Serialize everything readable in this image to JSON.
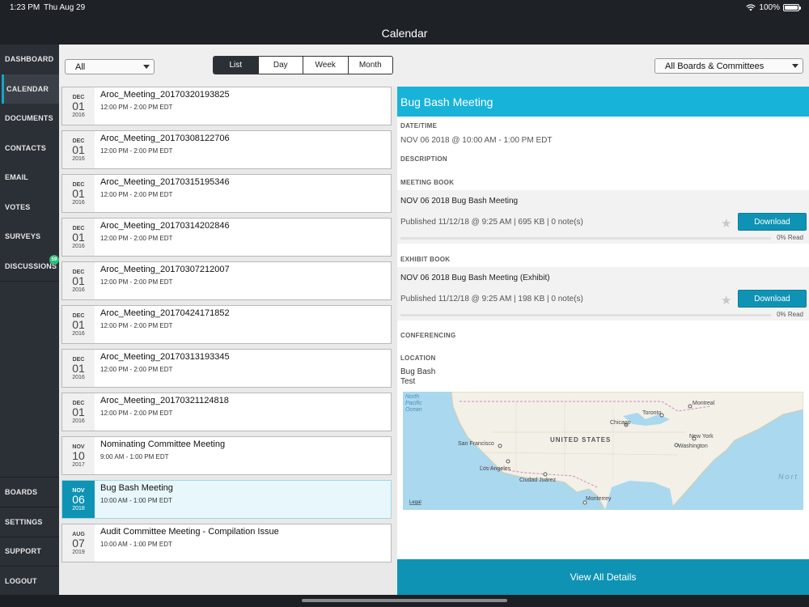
{
  "status_bar": {
    "time": "1:23 PM",
    "date": "Thu Aug 29",
    "battery": "100%",
    "battery_level": 1.0
  },
  "app_title": "Calendar",
  "sidebar": {
    "top_items": [
      {
        "label": "DASHBOARD"
      },
      {
        "label": "CALENDAR",
        "active": true
      },
      {
        "label": "DOCUMENTS"
      },
      {
        "label": "CONTACTS"
      },
      {
        "label": "EMAIL"
      },
      {
        "label": "VOTES"
      },
      {
        "label": "SURVEYS"
      },
      {
        "label": "DISCUSSIONS",
        "badge": "59"
      }
    ],
    "bottom_items": [
      {
        "label": "BOARDS"
      },
      {
        "label": "SETTINGS"
      },
      {
        "label": "SUPPORT"
      },
      {
        "label": "LOGOUT"
      }
    ]
  },
  "filters": {
    "type_select": "All",
    "view_tabs": [
      "List",
      "Day",
      "Week",
      "Month"
    ],
    "active_view": "List",
    "board_select": "All Boards & Committees"
  },
  "events": [
    {
      "mon": "DEC",
      "day": "01",
      "year": "2016",
      "title": "Aroc_Meeting_20170320193825",
      "time": "12:00 PM - 2:00 PM EDT"
    },
    {
      "mon": "DEC",
      "day": "01",
      "year": "2016",
      "title": "Aroc_Meeting_20170308122706",
      "time": "12:00 PM - 2:00 PM EDT"
    },
    {
      "mon": "DEC",
      "day": "01",
      "year": "2016",
      "title": "Aroc_Meeting_20170315195346",
      "time": "12:00 PM - 2:00 PM EDT"
    },
    {
      "mon": "DEC",
      "day": "01",
      "year": "2016",
      "title": "Aroc_Meeting_20170314202846",
      "time": "12:00 PM - 2:00 PM EDT"
    },
    {
      "mon": "DEC",
      "day": "01",
      "year": "2016",
      "title": "Aroc_Meeting_20170307212007",
      "time": "12:00 PM - 2:00 PM EDT"
    },
    {
      "mon": "DEC",
      "day": "01",
      "year": "2016",
      "title": "Aroc_Meeting_20170424171852",
      "time": "12:00 PM - 2:00 PM EDT"
    },
    {
      "mon": "DEC",
      "day": "01",
      "year": "2016",
      "title": "Aroc_Meeting_20170313193345",
      "time": "12:00 PM - 2:00 PM EDT"
    },
    {
      "mon": "DEC",
      "day": "01",
      "year": "2016",
      "title": "Aroc_Meeting_20170321124818",
      "time": "12:00 PM - 2:00 PM EDT"
    },
    {
      "mon": "NOV",
      "day": "10",
      "year": "2017",
      "title": "Nominating Committee Meeting",
      "time": "9:00 AM - 1:00 PM EDT"
    },
    {
      "mon": "NOV",
      "day": "06",
      "year": "2018",
      "title": "Bug Bash Meeting",
      "time": "10:00 AM - 1:00 PM EDT",
      "selected": true
    },
    {
      "mon": "AUG",
      "day": "07",
      "year": "2019",
      "title": "Audit Committee Meeting - Compilation Issue",
      "time": "10:00 AM - 1:00 PM EDT"
    }
  ],
  "detail": {
    "title": "Bug Bash Meeting",
    "datetime_label": "DATE/TIME",
    "datetime_value": "NOV 06 2018 @ 10:00 AM - 1:00 PM EDT",
    "description_label": "DESCRIPTION",
    "meeting_book_label": "MEETING BOOK",
    "meeting_book": {
      "title": "NOV 06 2018 Bug Bash Meeting",
      "meta": "Published 11/12/18 @ 9:25 AM | 695 KB | 0 note(s)",
      "button": "Download",
      "read": "0% Read",
      "read_fraction": 0.0
    },
    "exhibit_book_label": "EXHIBIT BOOK",
    "exhibit_book": {
      "title": "NOV 06 2018 Bug Bash Meeting (Exhibit)",
      "meta": "Published 11/12/18 @ 9:25 AM | 198 KB | 0 note(s)",
      "button": "Download",
      "read": "0% Read",
      "read_fraction": 0.0
    },
    "conferencing_label": "CONFERENCING",
    "location_label": "LOCATION",
    "location_line1": "Bug Bash",
    "location_line2": "Test",
    "map": {
      "ocean_label_1": "North",
      "ocean_label_2": "Pacific",
      "ocean_label_3": "Ocean",
      "country": "UNITED STATES",
      "legal": "Legal",
      "north_edge": "Nort",
      "cities": [
        "San Francisco",
        "Los Angeles",
        "Ciudad Juárez",
        "Monterrey",
        "Chicago",
        "Toronto",
        "Montreal",
        "New York",
        "Washington"
      ]
    },
    "view_all": "View All Details"
  }
}
